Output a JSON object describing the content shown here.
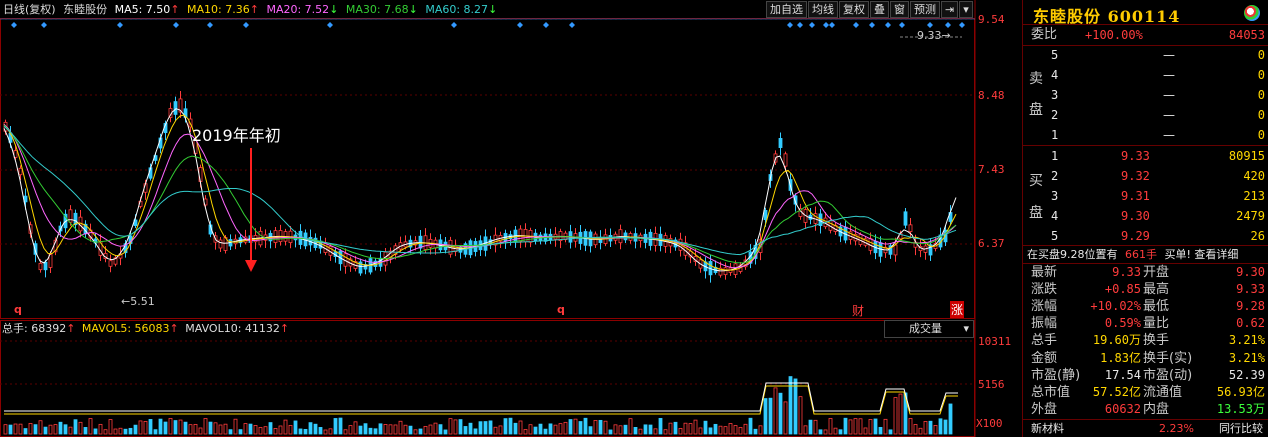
{
  "ma_header": {
    "period": "日线(复权)",
    "stock": "东睦股份",
    "ma5": "MA5: 7.50",
    "ma10": "MA10: 7.36",
    "ma20": "MA20: 7.52",
    "ma30": "MA30: 7.68",
    "ma60": "MA60: 8.27",
    "up_arrow": "↑",
    "down_arrow": "↓"
  },
  "toolbar": {
    "add_fav": "加自选",
    "ma_lines": "均线",
    "restore_right": "复权",
    "overlay": "叠",
    "window": "窗",
    "forecast": "预测",
    "menu_icon": "▾"
  },
  "annotation": "2019年年初",
  "price_axis": {
    "labels": [
      "9.54",
      "8.48",
      "7.43",
      "6.37"
    ],
    "last_price": "9.33→",
    "low_marker": "←5.51"
  },
  "markers": {
    "q1": "q",
    "q2": "q",
    "cai": "财",
    "zhang": "涨"
  },
  "volume": {
    "total": "总手: 68392",
    "mavol5": "MAVOL5: 56083",
    "mavol10": "MAVOL10: 41132",
    "select_label": "成交量",
    "axis": [
      "10311",
      "5156",
      "X100"
    ]
  },
  "colors": {
    "up": "#ff3c3c",
    "down": "#3cf",
    "ma5": "#ffffff",
    "ma10": "#ffd700",
    "ma20": "#ff66ff",
    "ma30": "#33cc33",
    "ma60": "#33cccc"
  },
  "panel": {
    "title": "东睦股份 600114",
    "weibi_label": "委比",
    "weibi_pct": "+100.00%",
    "weibi_val": "84053",
    "sell_label_1": "卖",
    "sell_label_2": "盘",
    "buy_label_1": "买",
    "buy_label_2": "盘",
    "sell": [
      {
        "n": "5",
        "p": "—",
        "v": "0"
      },
      {
        "n": "4",
        "p": "—",
        "v": "0"
      },
      {
        "n": "3",
        "p": "—",
        "v": "0"
      },
      {
        "n": "2",
        "p": "—",
        "v": "0"
      },
      {
        "n": "1",
        "p": "—",
        "v": "0"
      }
    ],
    "buy": [
      {
        "n": "1",
        "p": "9.33",
        "v": "80915"
      },
      {
        "n": "2",
        "p": "9.32",
        "v": "420"
      },
      {
        "n": "3",
        "p": "9.31",
        "v": "213"
      },
      {
        "n": "4",
        "p": "9.30",
        "v": "2479"
      },
      {
        "n": "5",
        "p": "9.29",
        "v": "26"
      }
    ],
    "trade_info_a": "在买盘9.28位置有",
    "trade_info_b": "661手",
    "trade_info_c": "买单! 查看详细",
    "stats": [
      {
        "l1": "最新",
        "v1": "9.33",
        "l2": "开盘",
        "v2": "9.30"
      },
      {
        "l1": "涨跌",
        "v1": "+0.85",
        "l2": "最高",
        "v2": "9.33"
      },
      {
        "l1": "涨幅",
        "v1": "+10.02%",
        "l2": "最低",
        "v2": "9.28"
      },
      {
        "l1": "振幅",
        "v1": "0.59%",
        "l2": "量比",
        "v2": "0.62"
      },
      {
        "l1": "总手",
        "v1": "19.60万",
        "l2": "换手",
        "v2": "3.21%"
      },
      {
        "l1": "金额",
        "v1": "1.83亿",
        "l2": "换手(实)",
        "v2": "3.21%"
      },
      {
        "l1": "市盈(静)",
        "v1": "17.54",
        "l2": "市盈(动)",
        "v2": "52.39"
      },
      {
        "l1": "总市值",
        "v1": "57.52亿",
        "l2": "流通值",
        "v2": "56.93亿"
      },
      {
        "l1": "外盘",
        "v1": "60632",
        "l2": "内盘",
        "v2": "13.53万"
      }
    ],
    "bottom_label": "新材料",
    "bottom_pct": "2.23%",
    "bottom_link": "同行比较"
  }
}
